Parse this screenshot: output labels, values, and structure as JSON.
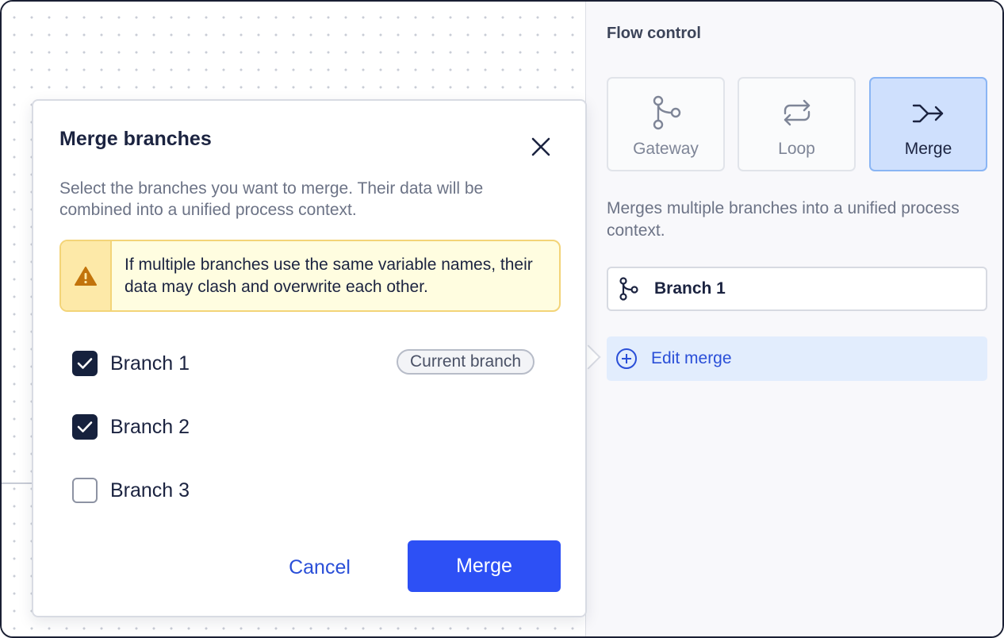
{
  "panel": {
    "title": "Flow control",
    "tiles": [
      {
        "label": "Gateway",
        "icon": "gateway-icon"
      },
      {
        "label": "Loop",
        "icon": "loop-icon"
      },
      {
        "label": "Merge",
        "icon": "merge-icon",
        "selected": true
      }
    ],
    "description": "Merges multiple branches into a unified process context.",
    "branch_field": {
      "label": "Branch 1",
      "icon": "branch-icon"
    },
    "edit_merge": {
      "label": "Edit merge",
      "icon": "plus-circle-icon"
    }
  },
  "dialog": {
    "title": "Merge branches",
    "description": "Select the branches you want to merge. Their data will be combined into a unified process context.",
    "warning": "If multiple branches use the same variable names, their data may clash and overwrite each other.",
    "branches": [
      {
        "label": "Branch 1",
        "checked": true,
        "badge": "Current branch"
      },
      {
        "label": "Branch 2",
        "checked": true
      },
      {
        "label": "Branch 3",
        "checked": false
      }
    ],
    "cancel_label": "Cancel",
    "merge_label": "Merge"
  },
  "colors": {
    "accent": "#2d50f5",
    "link": "#2a4fd8",
    "selected_tile_bg": "#cfe0fd",
    "warning_bg": "#fffde0",
    "warning_icon": "#c2730b",
    "checkbox_checked": "#16213d"
  }
}
